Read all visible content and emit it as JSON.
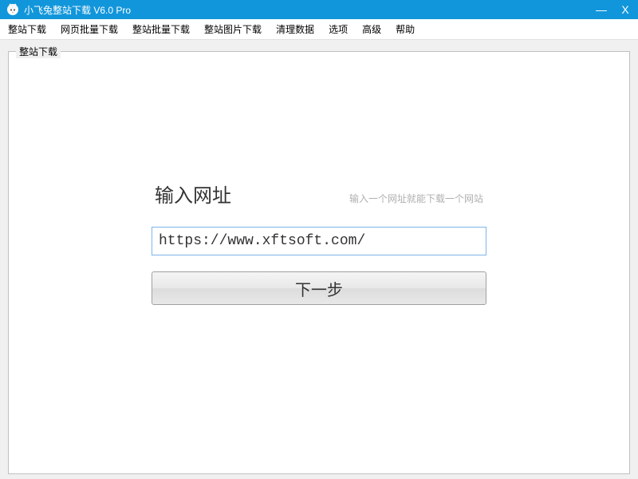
{
  "titlebar": {
    "title": "小飞兔整站下载 V6.0 Pro"
  },
  "menubar": {
    "items": [
      "整站下载",
      "网页批量下载",
      "整站批量下载",
      "整站图片下载",
      "清理数据",
      "选项",
      "高级",
      "帮助"
    ]
  },
  "tab": {
    "label": "整站下载"
  },
  "form": {
    "title": "输入网址",
    "hint": "输入一个网址就能下载一个网站",
    "url_value": "https://www.xftsoft.com/",
    "next_label": "下一步"
  }
}
